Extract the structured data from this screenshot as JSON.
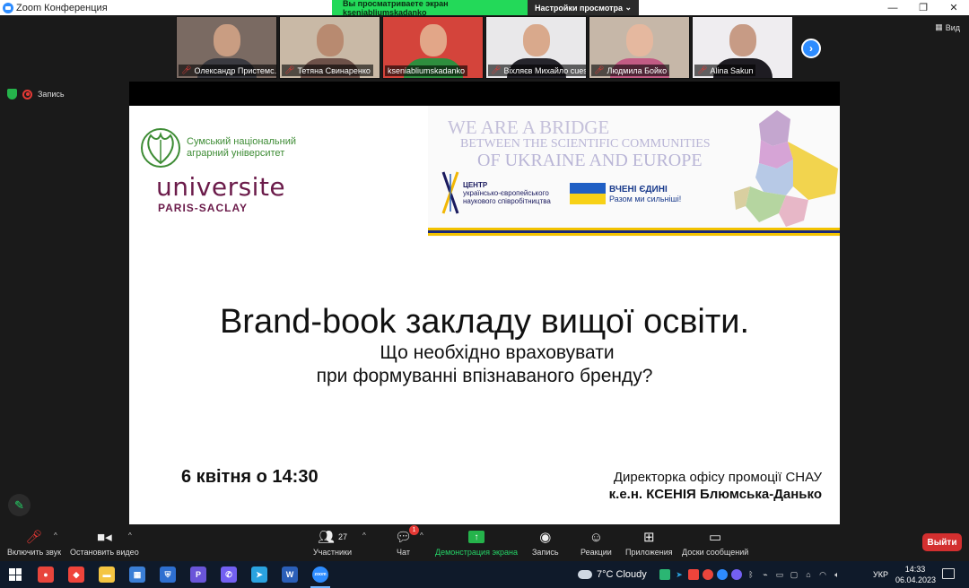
{
  "window": {
    "title": "Zoom Конференция",
    "share_notice": "Вы просматриваете экран kseniabliumskadanko",
    "view_options": "Настройки просмотра",
    "view_button": "Вид",
    "recording": "Запись"
  },
  "participants": [
    {
      "name": "Олександр Пристемс...",
      "bg": "#7a6a62",
      "head": "#c99d82",
      "body": "#3a3a40"
    },
    {
      "name": "Тетяна Свинаренко",
      "bg": "#c9b9a6",
      "head": "#b88a70",
      "body": "#6d5149"
    },
    {
      "name": "kseniabliumskadanko",
      "bg": "#d4443b",
      "head": "#e2a688",
      "body": "#2e8e3e",
      "muted": false
    },
    {
      "name": "Віхляєв Михайло cues...",
      "bg": "#e9e8ea",
      "head": "#d9a98c",
      "body": "#26252c"
    },
    {
      "name": "Людмила Бойко",
      "bg": "#c6b7a8",
      "head": "#e5b89f",
      "body": "#c25b84"
    },
    {
      "name": "Alina Sakun",
      "bg": "#efedf0",
      "head": "#c79b85",
      "body": "#1e1c22"
    }
  ],
  "slide": {
    "snau_line1": "Сумський національний",
    "snau_line2": "аграрний університет",
    "saclay_word": "universite",
    "saclay_sub": "PARIS-SACLAY",
    "banner_line1": "WE ARE A BRIDGE",
    "banner_line2": "BETWEEN THE SCIENTIFIC COMMUNITIES",
    "banner_line3": "OF UKRAINE AND EUROPE",
    "center_line1": "ЦЕНТР",
    "center_line2": "українсько-європейського",
    "center_line3": "наукового співробітництва",
    "vcheni": "ВЧЕНІ ЄДИНІ",
    "razom": "Разом ми сильніші!",
    "title": "Brand-book закладу вищої освіти.",
    "subtitle1": "Що необхідно враховувати",
    "subtitle2": "при формуванні впізнаваного бренду?",
    "date": "6 квітня о 14:30",
    "speaker_role": "Директорка офісу промоції СНАУ",
    "speaker_name": "к.е.н. КСЕНІЯ Блюмська-Данько"
  },
  "toolbar": {
    "unmute": "Включить звук",
    "stop_video": "Остановить видео",
    "participants": "Участники",
    "participants_count": "27",
    "chat": "Чат",
    "chat_badge": "1",
    "share": "Демонстрация экрана",
    "record": "Запись",
    "reactions": "Реакции",
    "apps": "Приложения",
    "whiteboards": "Доски сообщений",
    "leave": "Выйти"
  },
  "taskbar": {
    "weather": "7°C  Cloudy",
    "lang": "УКР",
    "time": "14:33",
    "date": "06.04.2023",
    "apps": [
      {
        "name": "chrome-icon",
        "color": "#e8453c",
        "glyph": "●"
      },
      {
        "name": "anydesk-icon",
        "color": "#ef443b",
        "glyph": "◆"
      },
      {
        "name": "file-explorer-icon",
        "color": "#f4c542",
        "glyph": "▬"
      },
      {
        "name": "store-icon",
        "color": "#3b7fd6",
        "glyph": "▦"
      },
      {
        "name": "security-icon",
        "color": "#2e6fd0",
        "glyph": "⛨"
      },
      {
        "name": "p-app-icon",
        "color": "#6a55d9",
        "glyph": "P"
      },
      {
        "name": "viber-icon",
        "color": "#7360f2",
        "glyph": "✆"
      },
      {
        "name": "telegram-icon",
        "color": "#2aa3e0",
        "glyph": "➤"
      },
      {
        "name": "word-icon",
        "color": "#2b5fb8",
        "glyph": "W"
      },
      {
        "name": "zoom-icon",
        "color": "#2d8cff",
        "glyph": "zoom"
      }
    ]
  }
}
